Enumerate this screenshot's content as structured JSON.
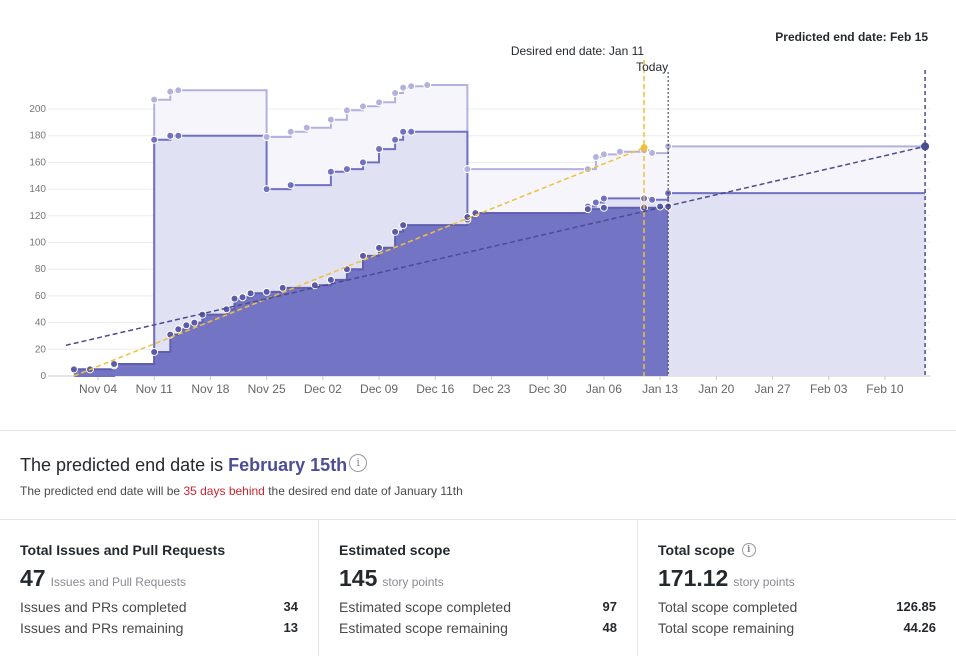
{
  "chart_data": {
    "type": "area",
    "x_type": "date",
    "x_ticks": [
      "Nov 04",
      "Nov 11",
      "Nov 18",
      "Nov 25",
      "Dec 02",
      "Dec 09",
      "Dec 16",
      "Dec 23",
      "Dec 30",
      "Jan 06",
      "Jan 13",
      "Jan 20",
      "Jan 27",
      "Feb 03",
      "Feb 10"
    ],
    "y_ticks": [
      0,
      20,
      40,
      60,
      80,
      100,
      120,
      140,
      160,
      180,
      200
    ],
    "ylim": [
      0,
      225
    ],
    "grid": true,
    "annotations": {
      "predicted_end": "Predicted end date: Feb 15",
      "desired_end": "Desired end date: Jan 11",
      "today": "Today"
    },
    "colors": {
      "completed_fill": "#7474c4",
      "estimated_fill": "#e1e1f4",
      "total_fill": "#f6f5fc",
      "estimated_line": "#7171c2",
      "total_line": "#b3b2de",
      "predicted_line": "#4b4b92",
      "desired_line": "#f0bf3f"
    },
    "series": [
      {
        "key": "total",
        "points": [
          [
            "2018-11-01",
            0
          ],
          [
            "2018-11-06",
            8
          ],
          [
            "2018-11-11",
            207
          ],
          [
            "2018-11-13",
            213
          ],
          [
            "2018-11-14",
            214
          ],
          [
            "2018-11-25",
            179
          ],
          [
            "2018-11-28",
            183
          ],
          [
            "2018-11-30",
            186
          ],
          [
            "2018-12-03",
            192
          ],
          [
            "2018-12-05",
            199
          ],
          [
            "2018-12-07",
            202
          ],
          [
            "2018-12-09",
            205
          ],
          [
            "2018-12-11",
            212
          ],
          [
            "2018-12-12",
            216
          ],
          [
            "2018-12-13",
            217
          ],
          [
            "2018-12-15",
            218
          ],
          [
            "2018-12-20",
            155
          ],
          [
            "2019-01-04",
            155
          ],
          [
            "2019-01-05",
            164
          ],
          [
            "2019-01-06",
            166
          ],
          [
            "2019-01-08",
            168
          ],
          [
            "2019-01-11",
            169
          ],
          [
            "2019-01-12",
            167
          ],
          [
            "2019-01-14",
            172
          ],
          [
            "2019-02-15",
            172
          ]
        ]
      },
      {
        "key": "estimated",
        "points": [
          [
            "2018-11-01",
            0
          ],
          [
            "2018-11-06",
            8
          ],
          [
            "2018-11-11",
            177
          ],
          [
            "2018-11-13",
            180
          ],
          [
            "2018-11-14",
            180
          ],
          [
            "2018-11-25",
            140
          ],
          [
            "2018-11-28",
            143
          ],
          [
            "2018-12-03",
            153
          ],
          [
            "2018-12-05",
            155
          ],
          [
            "2018-12-07",
            160
          ],
          [
            "2018-12-09",
            170
          ],
          [
            "2018-12-11",
            177
          ],
          [
            "2018-12-12",
            183
          ],
          [
            "2018-12-13",
            183
          ],
          [
            "2018-12-20",
            117
          ],
          [
            "2018-12-21",
            122
          ],
          [
            "2019-01-04",
            127
          ],
          [
            "2019-01-05",
            130
          ],
          [
            "2019-01-06",
            133
          ],
          [
            "2019-01-11",
            133
          ],
          [
            "2019-01-12",
            132
          ],
          [
            "2019-01-14",
            137
          ],
          [
            "2019-02-15",
            137
          ]
        ]
      },
      {
        "key": "completed",
        "points": [
          [
            "2018-11-01",
            5
          ],
          [
            "2018-11-03",
            5
          ],
          [
            "2018-11-06",
            9
          ],
          [
            "2018-11-11",
            18
          ],
          [
            "2018-11-13",
            31
          ],
          [
            "2018-11-14",
            35
          ],
          [
            "2018-11-15",
            38
          ],
          [
            "2018-11-16",
            40
          ],
          [
            "2018-11-17",
            46
          ],
          [
            "2018-11-20",
            50
          ],
          [
            "2018-11-21",
            58
          ],
          [
            "2018-11-22",
            59
          ],
          [
            "2018-11-23",
            62
          ],
          [
            "2018-11-25",
            63
          ],
          [
            "2018-11-27",
            66
          ],
          [
            "2018-12-01",
            68
          ],
          [
            "2018-12-03",
            72
          ],
          [
            "2018-12-05",
            80
          ],
          [
            "2018-12-07",
            90
          ],
          [
            "2018-12-09",
            96
          ],
          [
            "2018-12-11",
            108
          ],
          [
            "2018-12-12",
            113
          ],
          [
            "2018-12-20",
            119
          ],
          [
            "2018-12-21",
            122
          ],
          [
            "2019-01-04",
            125
          ],
          [
            "2019-01-06",
            126
          ],
          [
            "2019-01-11",
            126
          ],
          [
            "2019-01-13",
            127
          ],
          [
            "2019-01-14",
            127
          ]
        ]
      }
    ],
    "predicted_trend": [
      [
        "2018-10-31",
        23
      ],
      [
        "2019-02-15",
        172
      ]
    ],
    "desired_trend": [
      [
        "2018-11-01",
        0
      ],
      [
        "2019-01-11",
        171
      ]
    ]
  },
  "summary": {
    "headline_prefix": "The predicted end date is",
    "predicted_date": "February 15th",
    "sub_prefix": "The predicted end date will be",
    "sub_behind": "35 days behind",
    "sub_suffix": "the desired end date of January 11th"
  },
  "cards": [
    {
      "title": "Total Issues and Pull Requests",
      "big": "47",
      "unit": "Issues and Pull Requests",
      "rows": [
        {
          "label": "Issues and PRs completed",
          "value": "34"
        },
        {
          "label": "Issues and PRs remaining",
          "value": "13"
        }
      ]
    },
    {
      "title": "Estimated scope",
      "big": "145",
      "unit": "story points",
      "rows": [
        {
          "label": "Estimated scope completed",
          "value": "97"
        },
        {
          "label": "Estimated scope remaining",
          "value": "48"
        }
      ]
    },
    {
      "title": "Total scope",
      "big": "171.12",
      "unit": "story points",
      "rows": [
        {
          "label": "Total scope completed",
          "value": "126.85"
        },
        {
          "label": "Total scope remaining",
          "value": "44.26"
        }
      ]
    }
  ],
  "icons": {
    "info": "info-icon"
  }
}
